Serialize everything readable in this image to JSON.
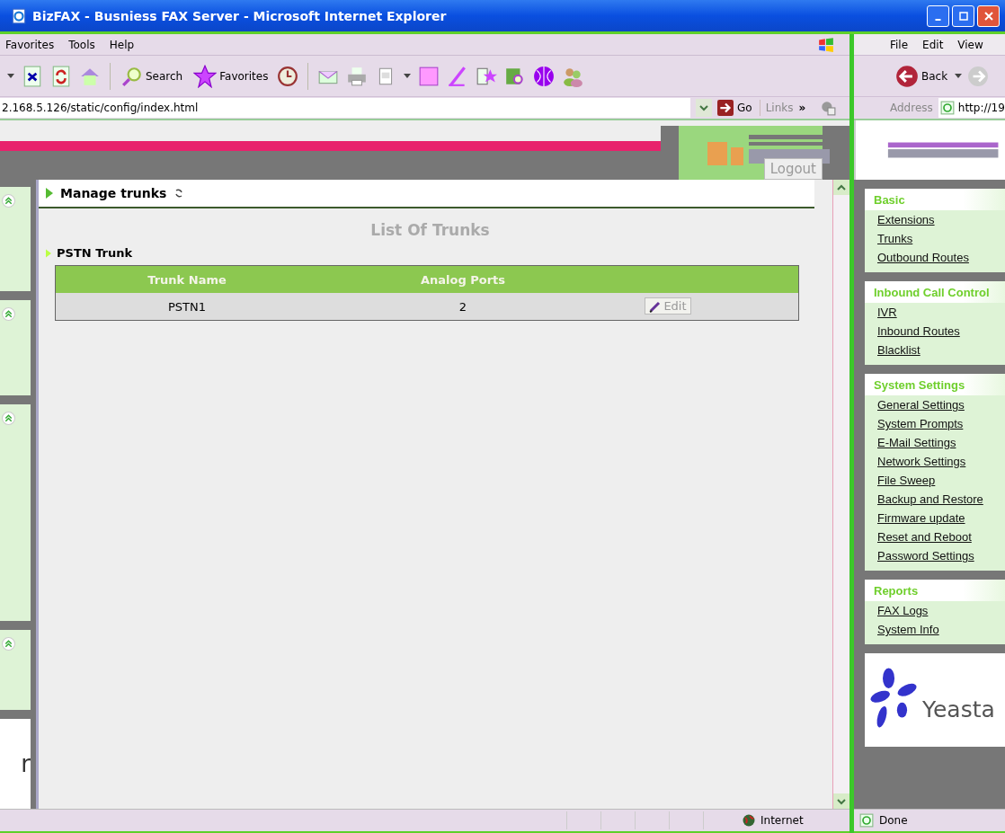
{
  "window": {
    "title": "BizFAX - Busniess FAX Server - Microsoft Internet Explorer"
  },
  "left_browser": {
    "menu": [
      "Favorites",
      "Tools",
      "Help"
    ],
    "toolbar": {
      "search": "Search",
      "favorites": "Favorites"
    },
    "address": {
      "url": "2.168.5.126/static/config/index.html",
      "go": "Go",
      "links": "Links",
      "links_more": "»"
    },
    "page": {
      "logout": "Logout",
      "section_title": "Manage trunks",
      "list_title": "List Of Trunks",
      "group_title": "PSTN Trunk",
      "table": {
        "columns": [
          "Trunk Name",
          "Analog Ports"
        ],
        "rows": [
          {
            "cells": [
              "PSTN1",
              "2"
            ],
            "action": "Edit"
          }
        ]
      },
      "side_fragment": "r"
    },
    "status": {
      "zone": "Internet"
    }
  },
  "right_browser": {
    "menu": [
      "File",
      "Edit",
      "View"
    ],
    "back": "Back",
    "address_label": "Address",
    "url": "http://19",
    "sidebar": [
      {
        "title": "Basic",
        "items": [
          "Extensions",
          "Trunks",
          "Outbound Routes"
        ]
      },
      {
        "title": "Inbound Call Control",
        "items": [
          "IVR",
          "Inbound Routes",
          "Blacklist"
        ]
      },
      {
        "title": "System Settings",
        "items": [
          "General Settings",
          "System Prompts",
          "E-Mail Settings",
          "Network Settings",
          "File Sweep",
          "Backup and Restore",
          "Firmware update",
          "Reset and Reboot",
          "Password Settings"
        ]
      },
      {
        "title": "Reports",
        "items": [
          "FAX Logs",
          "System Info"
        ]
      }
    ],
    "logo_text": "Yeasta",
    "status": "Done"
  }
}
